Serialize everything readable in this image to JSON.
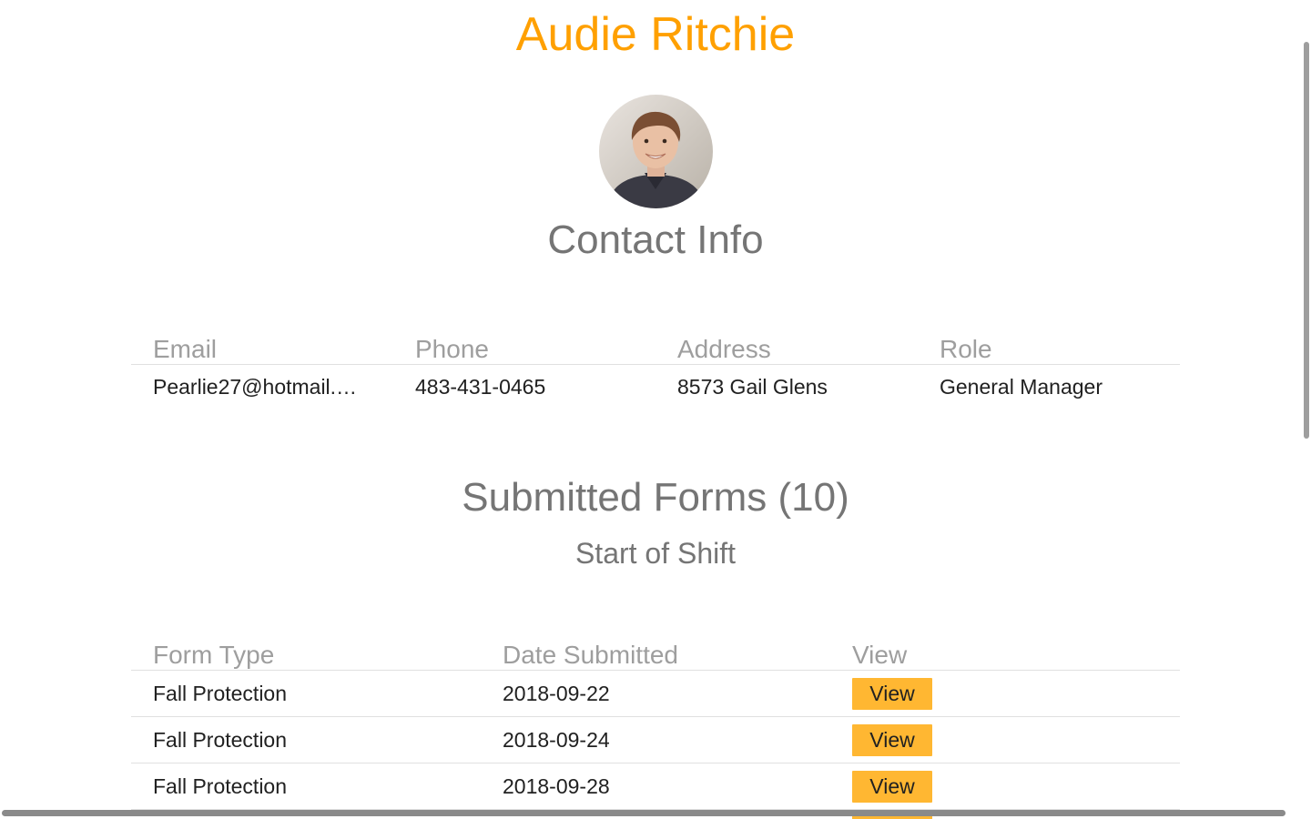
{
  "profile": {
    "name": "Audie Ritchie"
  },
  "contact": {
    "title": "Contact Info",
    "headers": [
      "Email",
      "Phone",
      "Address",
      "Role"
    ],
    "values": [
      "Pearlie27@hotmail.…",
      "483-431-0465",
      "8573 Gail Glens",
      "General Manager"
    ]
  },
  "forms": {
    "title": "Submitted Forms (10)",
    "subtitle": "Start of Shift",
    "headers": [
      "Form Type",
      "Date Submitted",
      "View"
    ],
    "rows": [
      {
        "type": "Fall Protection",
        "date": "2018-09-22",
        "action": "View"
      },
      {
        "type": "Fall Protection",
        "date": "2018-09-24",
        "action": "View"
      },
      {
        "type": "Fall Protection",
        "date": "2018-09-28",
        "action": "View"
      }
    ]
  },
  "colors": {
    "name_accent": "#ffa000",
    "button": "#ffb732"
  }
}
